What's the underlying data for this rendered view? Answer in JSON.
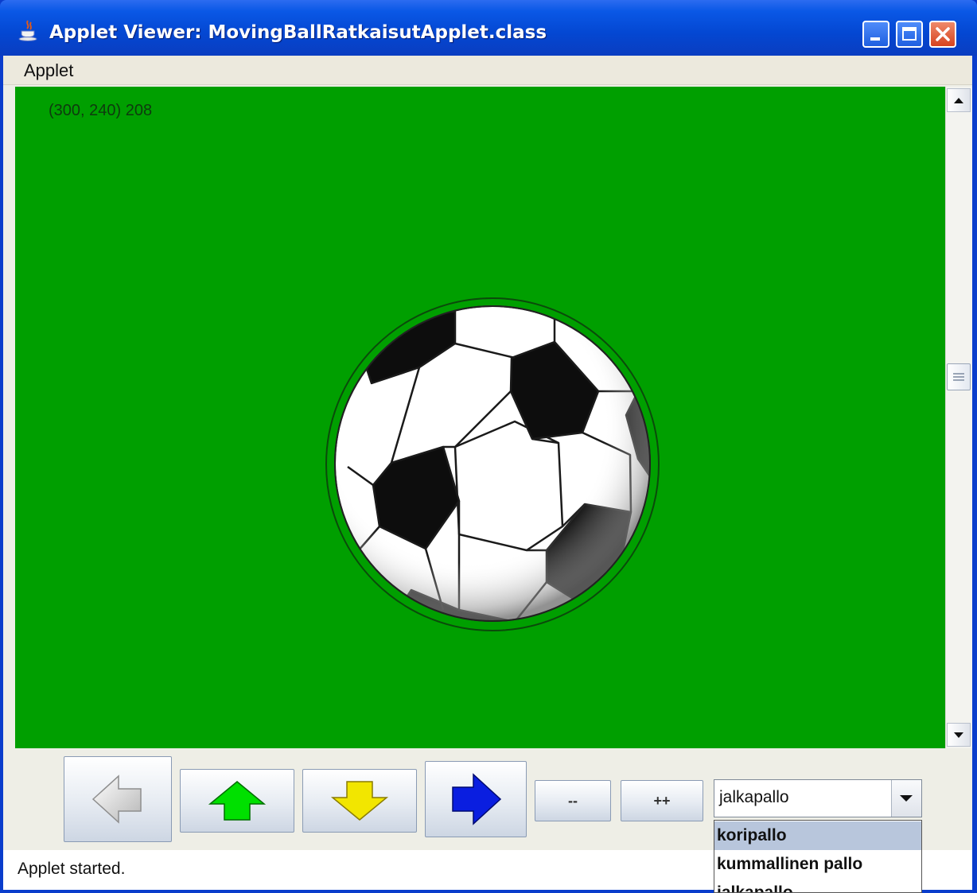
{
  "window": {
    "title": "Applet Viewer: MovingBallRatkaisutApplet.class",
    "icon": "java-cup-icon",
    "controls": [
      "minimize-icon",
      "maximize-icon",
      "close-icon"
    ]
  },
  "menubar": {
    "items": [
      {
        "label": "Applet"
      }
    ]
  },
  "canvas": {
    "background": "#009f00",
    "coords_text": "(300, 240)  208",
    "ball": "soccer-ball"
  },
  "controls": {
    "left_icon": "arrow-left-icon",
    "up_icon": "arrow-up-icon",
    "down_icon": "arrow-down-icon",
    "right_icon": "arrow-right-icon",
    "decrease_label": "--",
    "increase_label": "++",
    "ball_select": {
      "selected": "jalkapallo",
      "options": [
        "koripallo",
        "kummallinen pallo",
        "jalkapallo"
      ],
      "highlighted": "koripallo"
    }
  },
  "status": {
    "text": "Applet started."
  },
  "colors": {
    "up_arrow": "#00e000",
    "down_arrow": "#f2e600",
    "right_arrow": "#0a1ee0",
    "left_arrow": "#d8d8d8"
  }
}
